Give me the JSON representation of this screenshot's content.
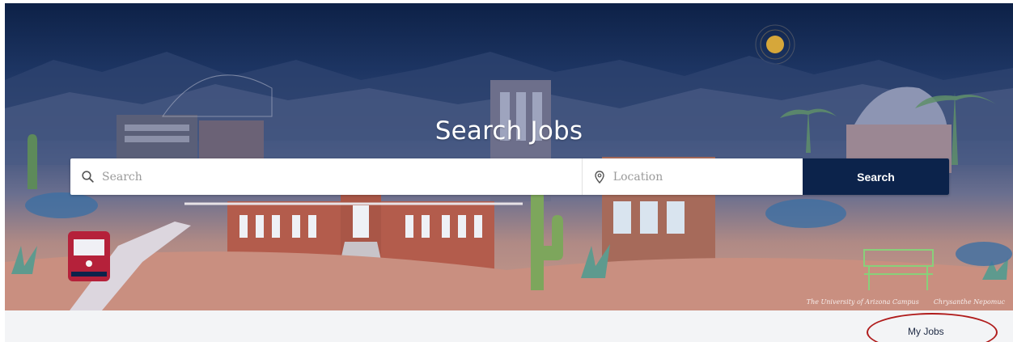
{
  "hero": {
    "title": "Search Jobs",
    "credit_left": "The University of Arizona Campus",
    "credit_right": "Chrysanthe Nepomuc"
  },
  "search": {
    "keyword_placeholder": "Search",
    "location_placeholder": "Location",
    "button_label": "Search"
  },
  "nav": {
    "my_jobs_label": "My Jobs"
  },
  "colors": {
    "brand_navy": "#0c234b",
    "highlight_red": "#b01c1c",
    "subbar_bg": "#f3f4f6"
  }
}
